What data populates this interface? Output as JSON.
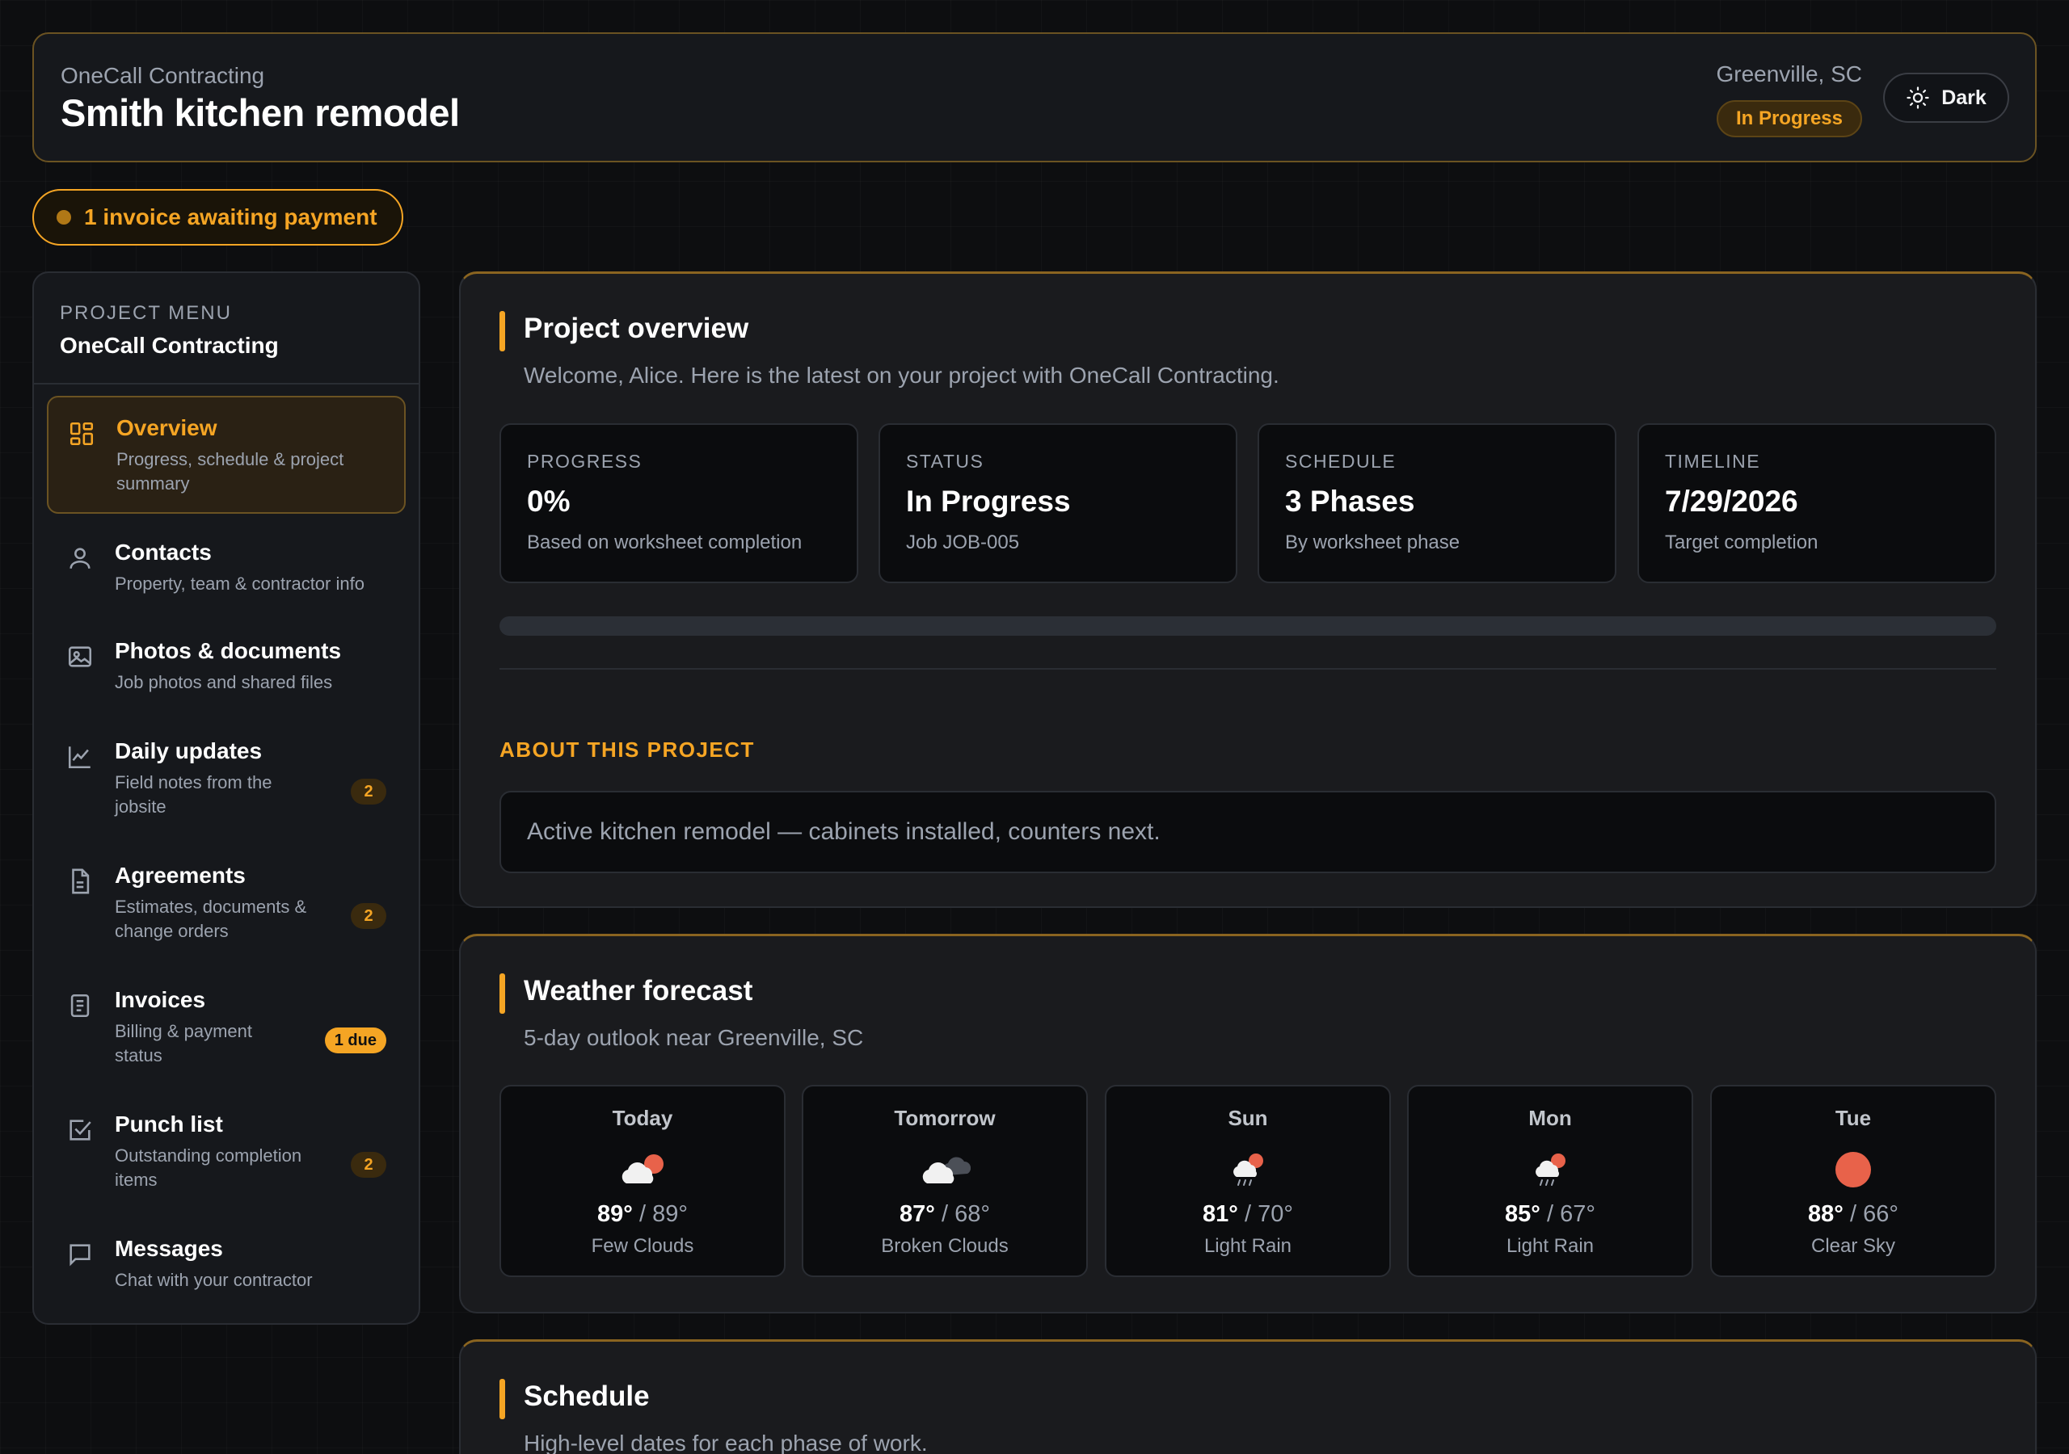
{
  "header": {
    "company": "OneCall Contracting",
    "title": "Smith kitchen remodel",
    "location": "Greenville, SC",
    "status": "In Progress",
    "theme_label": "Dark"
  },
  "alert": {
    "text": "1 invoice awaiting payment"
  },
  "sidebar": {
    "menu_label": "PROJECT MENU",
    "company": "OneCall Contracting",
    "items": [
      {
        "title": "Overview",
        "desc": "Progress, schedule & project summary",
        "icon": "grid-icon",
        "active": true
      },
      {
        "title": "Contacts",
        "desc": "Property, team & contractor info",
        "icon": "person-icon"
      },
      {
        "title": "Photos & documents",
        "desc": "Job photos and shared files",
        "icon": "image-icon"
      },
      {
        "title": "Daily updates",
        "desc": "Field notes from the jobsite",
        "icon": "chart-icon",
        "badge": "2"
      },
      {
        "title": "Agreements",
        "desc": "Estimates, documents & change orders",
        "icon": "document-icon",
        "badge": "2"
      },
      {
        "title": "Invoices",
        "desc": "Billing & payment status",
        "icon": "invoice-icon",
        "badge": "1 due"
      },
      {
        "title": "Punch list",
        "desc": "Outstanding completion items",
        "icon": "checkbox-icon",
        "badge": "2"
      },
      {
        "title": "Messages",
        "desc": "Chat with your contractor",
        "icon": "message-icon"
      }
    ]
  },
  "overview": {
    "title": "Project overview",
    "subtitle": "Welcome, Alice. Here is the latest on your project with OneCall Contracting.",
    "stats": [
      {
        "label": "PROGRESS",
        "value": "0%",
        "note": "Based on worksheet completion"
      },
      {
        "label": "STATUS",
        "value": "In Progress",
        "note": "Job JOB-005"
      },
      {
        "label": "SCHEDULE",
        "value": "3 Phases",
        "note": "By worksheet phase"
      },
      {
        "label": "TIMELINE",
        "value": "7/29/2026",
        "note": "Target completion"
      }
    ],
    "progress_percent": 0,
    "about_label": "ABOUT THIS PROJECT",
    "about_text": "Active kitchen remodel — cabinets installed, counters next."
  },
  "weather": {
    "title": "Weather forecast",
    "subtitle": "5-day outlook near Greenville, SC",
    "days": [
      {
        "name": "Today",
        "high": "89°",
        "low": "89°",
        "cond": "Few Clouds",
        "icon": "few-clouds-icon"
      },
      {
        "name": "Tomorrow",
        "high": "87°",
        "low": "68°",
        "cond": "Broken Clouds",
        "icon": "broken-clouds-icon"
      },
      {
        "name": "Sun",
        "high": "81°",
        "low": "70°",
        "cond": "Light Rain",
        "icon": "light-rain-icon"
      },
      {
        "name": "Mon",
        "high": "85°",
        "low": "67°",
        "cond": "Light Rain",
        "icon": "light-rain-icon"
      },
      {
        "name": "Tue",
        "high": "88°",
        "low": "66°",
        "cond": "Clear Sky",
        "icon": "clear-sky-icon"
      }
    ]
  },
  "schedule": {
    "title": "Schedule",
    "subtitle": "High-level dates for each phase of work."
  },
  "colors": {
    "accent": "#f5a524",
    "background": "#0d0e10",
    "card": "#1a1b1e"
  }
}
